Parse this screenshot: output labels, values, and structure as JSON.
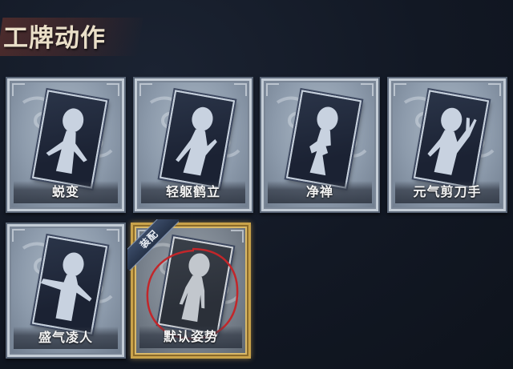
{
  "header": {
    "title": "工牌动作"
  },
  "cards": [
    {
      "label": "蜕变",
      "pose": "arms-open",
      "equipped": false
    },
    {
      "label": "轻躯鹤立",
      "pose": "graceful",
      "equipped": false
    },
    {
      "label": "净禅",
      "pose": "meditate",
      "equipped": false
    },
    {
      "label": "元气剪刀手",
      "pose": "peace-sign",
      "equipped": false
    },
    {
      "label": "盛气凌人",
      "pose": "proud",
      "equipped": false
    },
    {
      "label": "默认姿势",
      "pose": "default",
      "equipped": true,
      "badge": "装配"
    }
  ],
  "colors": {
    "background": "#121824",
    "frame_gold": "#c9a24a",
    "header_ribbon": "#783730",
    "highlight_circle": "#c2262a"
  }
}
